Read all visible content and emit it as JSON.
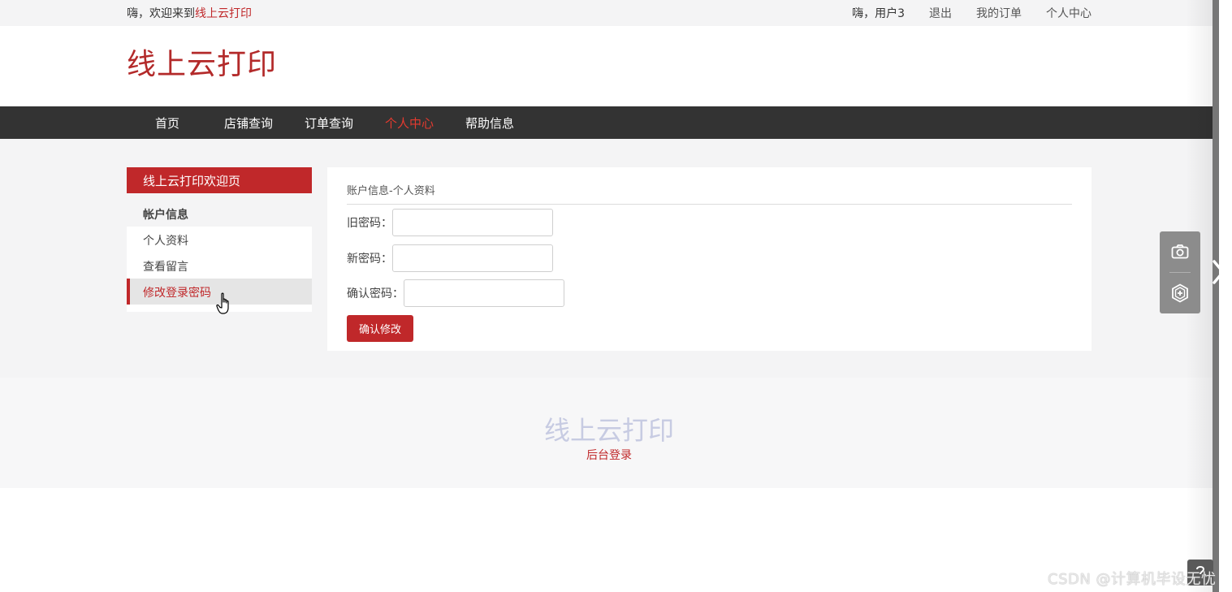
{
  "topbar": {
    "welcome_prefix": "嗨，欢迎来到",
    "welcome_brand": "线上云打印",
    "greeting": "嗨，用户3",
    "logout": "退出",
    "my_orders": "我的订单",
    "profile": "个人中心"
  },
  "header": {
    "logo": "线上云打印"
  },
  "nav": {
    "items": [
      {
        "label": "首页"
      },
      {
        "label": "店铺查询"
      },
      {
        "label": "订单查询"
      },
      {
        "label": "个人中心"
      },
      {
        "label": "帮助信息"
      }
    ],
    "active": "个人中心"
  },
  "sidebar": {
    "title": "线上云打印欢迎页",
    "group": "帐户信息",
    "items": [
      {
        "label": "个人资料"
      },
      {
        "label": "查看留言"
      },
      {
        "label": "修改登录密码"
      }
    ],
    "active": "修改登录密码"
  },
  "panel": {
    "title": "账户信息-个人资料",
    "fields": [
      {
        "label": "旧密码：",
        "value": ""
      },
      {
        "label": "新密码：",
        "value": ""
      },
      {
        "label": "确认密码：",
        "value": ""
      }
    ],
    "submit": "确认修改"
  },
  "footer": {
    "logo": "线上云打印",
    "admin_link": "后台登录"
  },
  "overlay": {
    "tools": [
      "camera-icon",
      "hexagon-plus-icon"
    ],
    "watermark": "CSDN @计算机毕设无忧"
  },
  "colors": {
    "accent": "#c0282a",
    "nav_bg": "#333333",
    "nav_active": "#e43a2f",
    "footer_logo": "#c7cbe2"
  }
}
